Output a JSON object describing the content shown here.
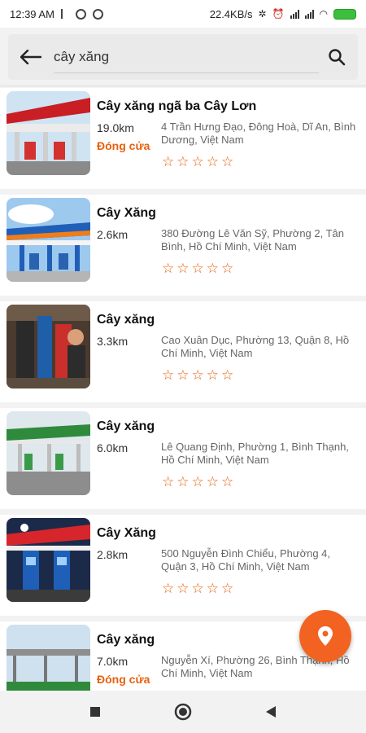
{
  "status": {
    "time": "12:39 AM",
    "speed": "22.4KB/s",
    "battery_color": "#3cbf3c"
  },
  "search": {
    "query": "cây xăng",
    "back_icon": "arrow-left-icon",
    "search_icon": "search-icon"
  },
  "theme": {
    "accent": "#e8600e",
    "fab": "#f26321"
  },
  "results": [
    {
      "name": "Cây xăng ngã ba Cây Lơn",
      "distance": "19.0km",
      "status": "Đóng cửa",
      "address": "4 Trần Hưng Đạo, Đông Hoà, Dĩ An, Bình Dương, Việt Nam",
      "rating": 0
    },
    {
      "name": "Cây Xăng",
      "distance": "2.6km",
      "status": "",
      "address": "380 Đường Lê Văn Sỹ, Phường 2, Tân Bình, Hồ Chí Minh, Việt Nam",
      "rating": 0
    },
    {
      "name": "Cây xăng",
      "distance": "3.3km",
      "status": "",
      "address": "Cao Xuân Dục, Phường 13, Quận 8, Hồ Chí Minh, Việt Nam",
      "rating": 0
    },
    {
      "name": "Cây xăng",
      "distance": "6.0km",
      "status": "",
      "address": "Lê Quang Định, Phường 1, Bình Thạnh, Hồ Chí Minh, Việt Nam",
      "rating": 0
    },
    {
      "name": "Cây Xăng",
      "distance": "2.8km",
      "status": "",
      "address": "500 Nguyễn Đình Chiểu, Phường 4, Quận 3, Hồ Chí Minh, Việt Nam",
      "rating": 0
    },
    {
      "name": "Cây xăng",
      "distance": "7.0km",
      "status": "Đóng cửa",
      "address": "Nguyễn Xí, Phường 26, Bình Thạnh, Hồ Chí Minh, Việt Nam",
      "rating": 0
    }
  ],
  "fab": {
    "icon": "location-pin-icon"
  },
  "navbar": {
    "icons": [
      "recents-square-icon",
      "home-circle-icon",
      "back-triangle-icon"
    ]
  }
}
